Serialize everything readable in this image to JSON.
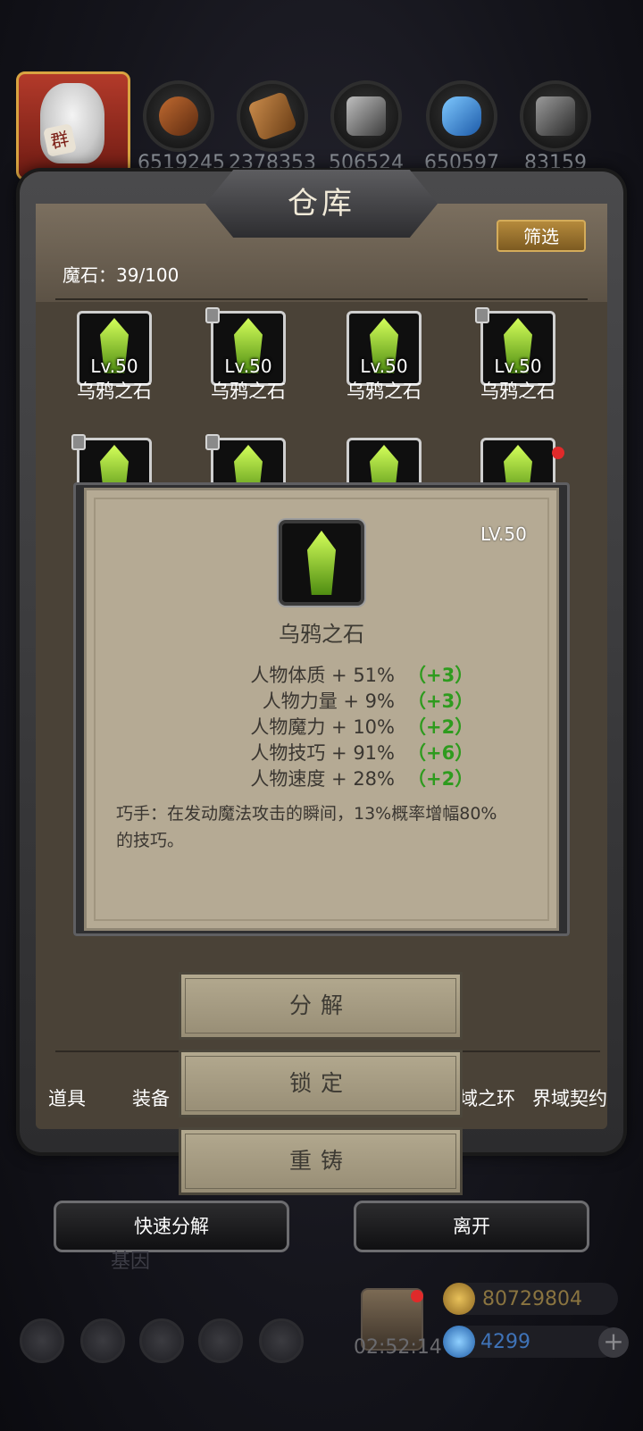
{
  "resources": [
    {
      "icon": "wood-log-icon",
      "value": "6519245"
    },
    {
      "icon": "plank-icon",
      "value": "2378353"
    },
    {
      "icon": "iron-ingot-icon",
      "value": "506524"
    },
    {
      "icon": "blue-crystal-icon",
      "value": "650597"
    },
    {
      "icon": "steel-ingot-icon",
      "value": "83159"
    }
  ],
  "avatar_seal": "群",
  "panel": {
    "title": "仓库",
    "filter_label": "筛选",
    "count_label": "魔石：39/100"
  },
  "items_row1": [
    {
      "level": "Lv.50",
      "name": "乌鸦之石",
      "locked": false
    },
    {
      "level": "Lv.50",
      "name": "乌鸦之石",
      "locked": true
    },
    {
      "level": "Lv.50",
      "name": "乌鸦之石",
      "locked": false
    },
    {
      "level": "Lv.50",
      "name": "乌鸦之石",
      "locked": true
    }
  ],
  "items_row2": [
    {
      "locked": true
    },
    {
      "locked": true
    },
    {
      "locked": false
    },
    {
      "locked": false,
      "new": true
    }
  ],
  "tabs": [
    "道具",
    "装备",
    "域之环",
    "界域契约"
  ],
  "detail": {
    "level": "LV.50",
    "name": "乌鸦之石",
    "stats": [
      {
        "label": "人物体质 + 51%",
        "bonus": "（+3）"
      },
      {
        "label": "人物力量 + 9%",
        "bonus": "（+3）"
      },
      {
        "label": "人物魔力 + 10%",
        "bonus": "（+2）"
      },
      {
        "label": "人物技巧 + 91%",
        "bonus": "（+6）"
      },
      {
        "label": "人物速度 + 28%",
        "bonus": "（+2）"
      }
    ],
    "description": "巧手：在发动魔法攻击的瞬间，13%概率增幅80%的技巧。"
  },
  "actions": {
    "decompose": "分解",
    "lock": "锁定",
    "recast": "重铸"
  },
  "bottom": {
    "quick_decompose": "快速分解",
    "leave": "离开",
    "behind_text": "基因",
    "timer": "02:52:14",
    "gold": "80729804",
    "gems": "4299"
  },
  "colors": {
    "accent_gold": "#b58a3c",
    "bonus_green": "#2e9b1e",
    "popup_bg": "#b5aa94"
  }
}
